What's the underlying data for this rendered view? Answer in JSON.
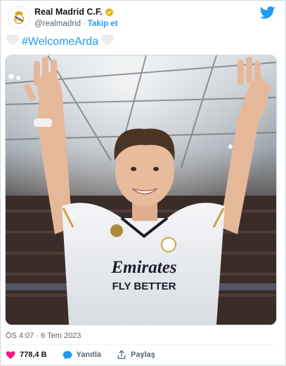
{
  "account": {
    "display_name": "Real Madrid C.F.",
    "handle": "@realmadrid",
    "separator": "·",
    "follow_label": "Takip et"
  },
  "tweet": {
    "hashtag": "#WelcomeArda",
    "heart_icon": "white-heart-emoji",
    "timestamp": "ÖS 4:07 · 6 Tem 2023"
  },
  "media": {
    "shirt_sponsor_line1": "Emirates",
    "shirt_sponsor_line2": "FLY BETTER"
  },
  "actions": {
    "like_count": "778,4 B",
    "reply_label": "Yanıtla",
    "share_label": "Paylaş"
  },
  "colors": {
    "accent": "#1d9bf0",
    "like": "#f91880",
    "verified": "#e2b719"
  }
}
